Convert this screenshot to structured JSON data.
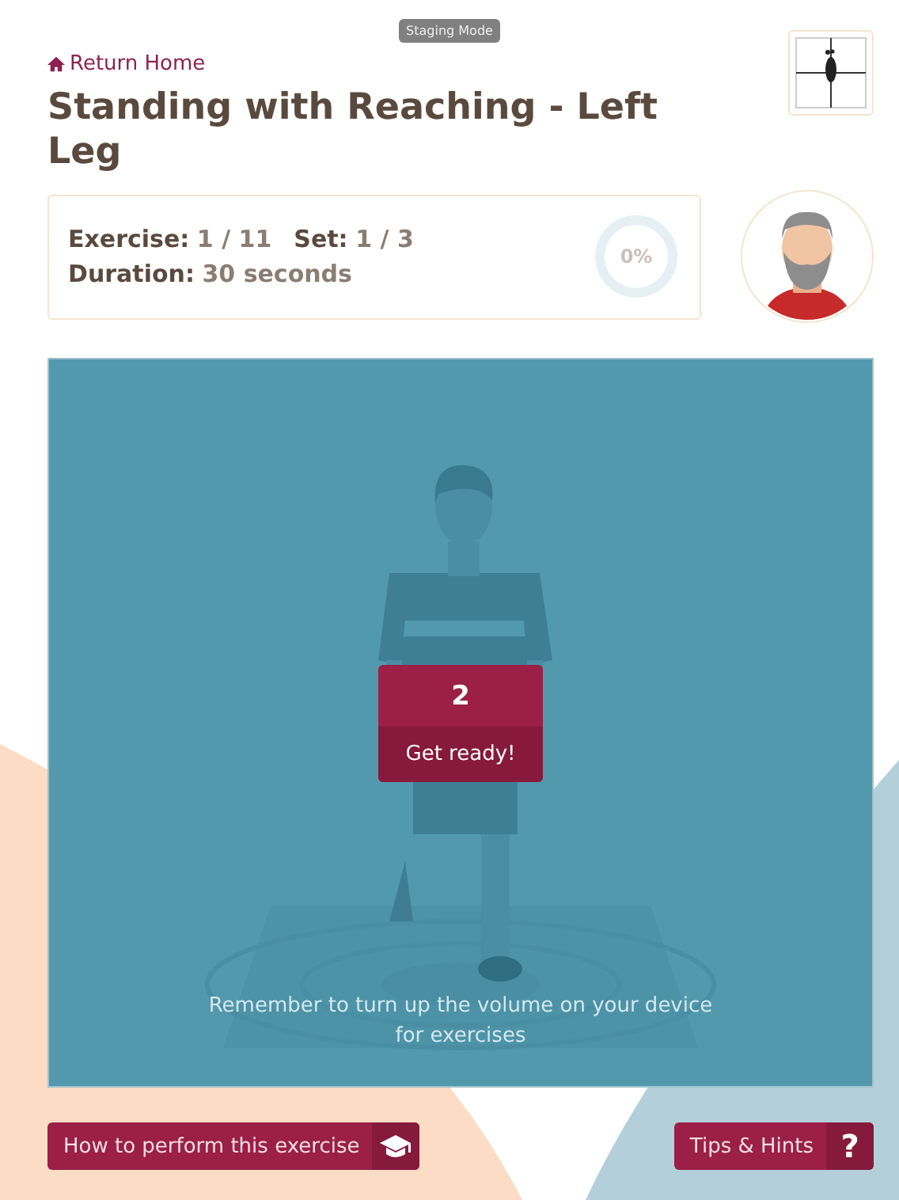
{
  "badge": "Staging Mode",
  "return_link": "Return Home",
  "title": "Standing with Reaching - Left Leg",
  "stats": [
    {
      "label": "Exercise:",
      "value": "1 / 11"
    },
    {
      "label": "Set:",
      "value": "1 / 3"
    },
    {
      "label": "Duration:",
      "value": "30 seconds"
    }
  ],
  "progress": {
    "level": 0,
    "reading": "0%"
  },
  "countdown": {
    "number": "2",
    "label": "Get ready!"
  },
  "reminder": "Remember to turn up the volume on your device for exercises",
  "buttons": [
    {
      "kind": "cap",
      "label": "How to perform this exercise"
    },
    {
      "kind": "glyph",
      "label": "Tips & Hints",
      "icon": "?"
    }
  ]
}
